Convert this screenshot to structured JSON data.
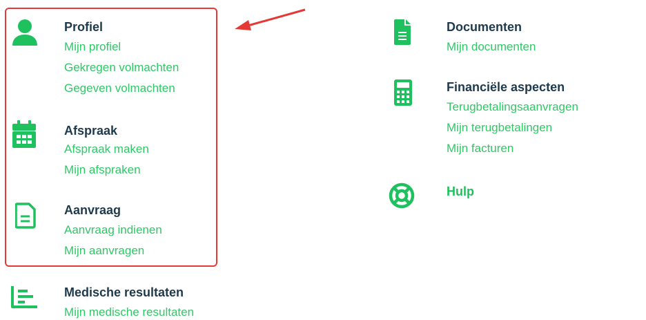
{
  "colors": {
    "accent": "#1fc15e",
    "link": "#2ec866",
    "title": "#1e3a4d",
    "highlight": "#e53935"
  },
  "sections": {
    "profiel": {
      "icon": "user-icon",
      "title": "Profiel",
      "links": [
        "Mijn profiel",
        "Gekregen volmachten",
        "Gegeven volmachten"
      ]
    },
    "afspraak": {
      "icon": "calendar-icon",
      "title": "Afspraak",
      "links": [
        "Afspraak maken",
        "Mijn afspraken"
      ]
    },
    "aanvraag": {
      "icon": "document-outline-icon",
      "title": "Aanvraag",
      "links": [
        "Aanvraag indienen",
        "Mijn aanvragen"
      ]
    },
    "medisch": {
      "icon": "chart-icon",
      "title": "Medische resultaten",
      "links": [
        "Mijn medische resultaten"
      ]
    },
    "documenten": {
      "icon": "file-icon",
      "title": "Documenten",
      "links": [
        "Mijn documenten"
      ]
    },
    "financieel": {
      "icon": "calculator-icon",
      "title": "Financiële aspecten",
      "links": [
        "Terugbetalingsaanvragen",
        "Mijn terugbetalingen",
        "Mijn facturen"
      ]
    },
    "hulp": {
      "icon": "lifebuoy-icon",
      "title": "Hulp"
    }
  }
}
